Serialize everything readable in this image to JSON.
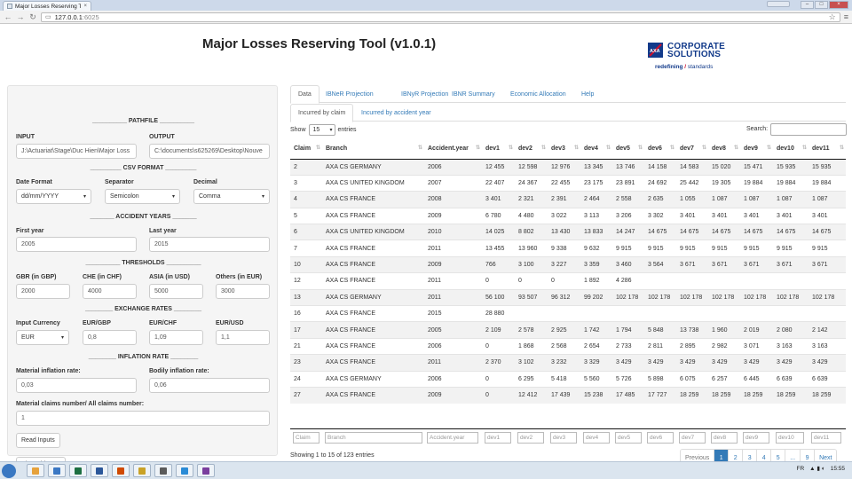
{
  "browser": {
    "tab_title": "Major Losses Reserving T",
    "tab_close": "×",
    "address_host": "127.0.0.1",
    "address_port": ":6025",
    "back": "←",
    "forward": "→",
    "reload": "↻",
    "star": "☆",
    "menu": "≡",
    "win_min": "–",
    "win_max": "□",
    "win_close": "×"
  },
  "app": {
    "title": "Major Losses Reserving Tool (v1.0.1)",
    "logo_line1": "CORPORATE",
    "logo_line2": "SOLUTIONS",
    "logo_tag_a": "redefining",
    "logo_tag_slash": "/",
    "logo_tag_b": "standards"
  },
  "sidebar": {
    "pathfile_head": "__________ PATHFILE __________",
    "input_label": "INPUT",
    "input_value": "J:\\Actuariat\\Stage\\Duc Hien\\Major Loss",
    "output_label": "OUTPUT",
    "output_value": "C:\\documents\\s625269\\Desktop\\Nouve",
    "csv_head": "_________ CSV FORMAT _________",
    "date_format_label": "Date Format",
    "date_format_value": "dd/mm/YYYY",
    "separator_label": "Separator",
    "separator_value": "Semicolon",
    "decimal_label": "Decimal",
    "decimal_value": "Comma",
    "accident_head": "_______ ACCIDENT YEARS _______",
    "first_year_label": "First year",
    "first_year_value": "2005",
    "last_year_label": "Last year",
    "last_year_value": "2015",
    "thresholds_head": "__________ THRESHOLDS __________",
    "gbr_label": "GBR (in GBP)",
    "gbr_value": "2000",
    "che_label": "CHE (in CHF)",
    "che_value": "4000",
    "asia_label": "ASIA (in USD)",
    "asia_value": "5000",
    "others_label": "Others (in EUR)",
    "others_value": "3000",
    "exchange_head": "________ EXCHANGE RATES ________",
    "currency_label": "Input Currency",
    "currency_value": "EUR",
    "eurgbp_label": "EUR/GBP",
    "eurgbp_value": "0,8",
    "eurchf_label": "EUR/CHF",
    "eurchf_value": "1,09",
    "eurusd_label": "EUR/USD",
    "eurusd_value": "1,1",
    "inflation_head": "________ INFLATION RATE ________",
    "mat_infl_label": "Material inflation rate:",
    "mat_infl_value": "0,03",
    "bod_infl_label": "Bodily inflation rate:",
    "bod_infl_value": "0,06",
    "ratio_label": "Material claims number/ All claims number:",
    "ratio_value": "1",
    "read_button": "Read Inputs",
    "close_button": "Close this app",
    "caret": "▾"
  },
  "tabs": [
    "Data",
    "IBNeR Projection",
    "IBNyR Projection",
    "IBNR Summary",
    "Economic Allocation",
    "Help"
  ],
  "subtabs": [
    "Incurred by claim",
    "Incurred by accident year"
  ],
  "table": {
    "show_label": "Show",
    "entries_value": "15",
    "entries_label": "entries",
    "search_label": "Search:",
    "columns": [
      "Claim",
      "Branch",
      "Accident.year",
      "dev1",
      "dev2",
      "dev3",
      "dev4",
      "dev5",
      "dev6",
      "dev7",
      "dev8",
      "dev9",
      "dev10",
      "dev11"
    ],
    "rows": [
      [
        "2",
        "AXA CS GERMANY",
        "2006",
        "12 455",
        "12 598",
        "12 976",
        "13 345",
        "13 746",
        "14 158",
        "14 583",
        "15 020",
        "15 471",
        "15 935",
        "15 935"
      ],
      [
        "3",
        "AXA CS UNITED KINGDOM",
        "2007",
        "22 407",
        "24 367",
        "22 455",
        "23 175",
        "23 891",
        "24 692",
        "25 442",
        "19 305",
        "19 884",
        "19 884",
        "19 884"
      ],
      [
        "4",
        "AXA CS FRANCE",
        "2008",
        "3 401",
        "2 321",
        "2 391",
        "2 464",
        "2 558",
        "2 635",
        "1 055",
        "1 087",
        "1 087",
        "1 087",
        "1 087"
      ],
      [
        "5",
        "AXA CS FRANCE",
        "2009",
        "6 780",
        "4 480",
        "3 022",
        "3 113",
        "3 206",
        "3 302",
        "3 401",
        "3 401",
        "3 401",
        "3 401",
        "3 401"
      ],
      [
        "6",
        "AXA CS UNITED KINGDOM",
        "2010",
        "14 025",
        "8 802",
        "13 430",
        "13 833",
        "14 247",
        "14 675",
        "14 675",
        "14 675",
        "14 675",
        "14 675",
        "14 675"
      ],
      [
        "7",
        "AXA CS FRANCE",
        "2011",
        "13 455",
        "13 960",
        "9 338",
        "9 632",
        "9 915",
        "9 915",
        "9 915",
        "9 915",
        "9 915",
        "9 915",
        "9 915"
      ],
      [
        "10",
        "AXA CS FRANCE",
        "2009",
        "766",
        "3 100",
        "3 227",
        "3 359",
        "3 460",
        "3 564",
        "3 671",
        "3 671",
        "3 671",
        "3 671",
        "3 671"
      ],
      [
        "12",
        "AXA CS FRANCE",
        "2011",
        "0",
        "0",
        "0",
        "1 892",
        "4 286",
        "",
        "",
        "",
        "",
        "",
        ""
      ],
      [
        "13",
        "AXA CS GERMANY",
        "2011",
        "56 100",
        "93 507",
        "96 312",
        "99 202",
        "102 178",
        "102 178",
        "102 178",
        "102 178",
        "102 178",
        "102 178",
        "102 178"
      ],
      [
        "16",
        "AXA CS FRANCE",
        "2015",
        "28 880",
        "",
        "",
        "",
        "",
        "",
        "",
        "",
        "",
        "",
        ""
      ],
      [
        "17",
        "AXA CS FRANCE",
        "2005",
        "2 109",
        "2 578",
        "2 925",
        "1 742",
        "1 794",
        "5 848",
        "13 738",
        "1 960",
        "2 019",
        "2 080",
        "2 142"
      ],
      [
        "21",
        "AXA CS FRANCE",
        "2006",
        "0",
        "1 868",
        "2 568",
        "2 654",
        "2 733",
        "2 811",
        "2 895",
        "2 982",
        "3 071",
        "3 163",
        "3 163"
      ],
      [
        "23",
        "AXA CS FRANCE",
        "2011",
        "2 370",
        "3 102",
        "3 232",
        "3 329",
        "3 429",
        "3 429",
        "3 429",
        "3 429",
        "3 429",
        "3 429",
        "3 429"
      ],
      [
        "24",
        "AXA CS GERMANY",
        "2006",
        "0",
        "6 295",
        "5 418",
        "5 560",
        "5 726",
        "5 898",
        "6 075",
        "6 257",
        "6 445",
        "6 639",
        "6 639"
      ],
      [
        "27",
        "AXA CS FRANCE",
        "2009",
        "0",
        "12 412",
        "17 439",
        "15 238",
        "17 485",
        "17 727",
        "18 259",
        "18 259",
        "18 259",
        "18 259",
        "18 259"
      ]
    ],
    "filter_placeholders": [
      "Claim",
      "Branch",
      "Accident.year",
      "dev1",
      "dev2",
      "dev3",
      "dev4",
      "dev5",
      "dev6",
      "dev7",
      "dev8",
      "dev9",
      "dev10",
      "dev11"
    ],
    "info": "Showing 1 to 15 of 123 entries",
    "pager": [
      "Previous",
      "1",
      "2",
      "3",
      "4",
      "5",
      "...",
      "9",
      "Next"
    ],
    "active_page": "1"
  },
  "taskbar": {
    "lang": "FR",
    "time": "15:55"
  },
  "colors": {
    "link": "#337ab7",
    "brand": "#123a8a",
    "brand_red": "#c8102e"
  }
}
